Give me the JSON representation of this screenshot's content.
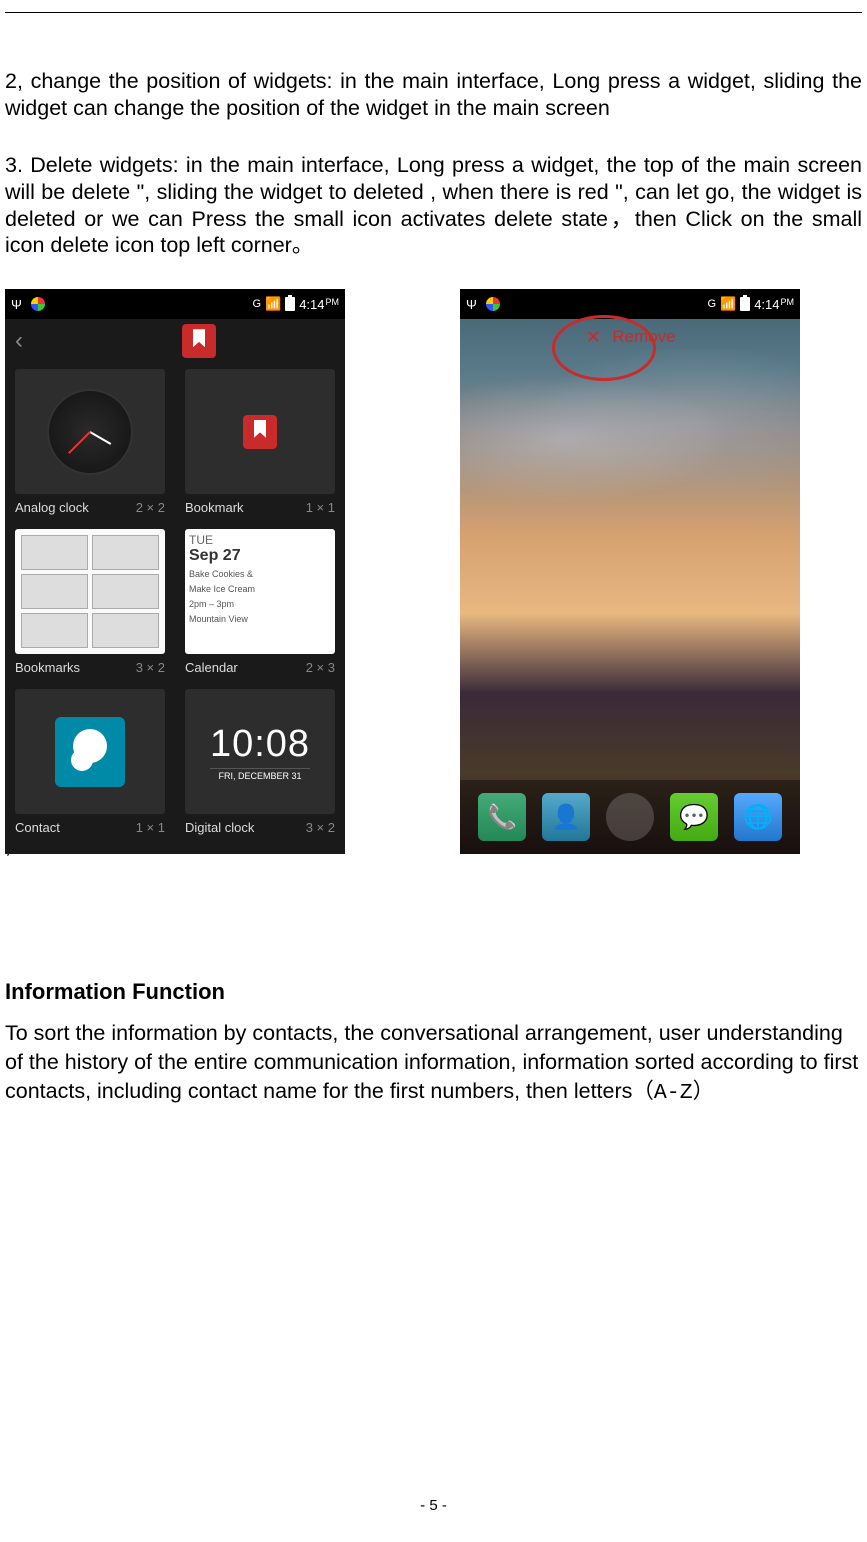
{
  "para1": "2, change the position of widgets: in the main interface, Long press a widget, sliding the widget can change the position of the widget in the main screen",
  "para2": "3. Delete widgets: in the main interface, Long press a widget, the top of the main screen will be delete \", sliding the widget to deleted , when there is red \", can let go, the widget is deleted or we can Press the small icon activates delete state，then Click on the small icon delete icon top left corner。",
  "ss1": {
    "status": {
      "gi": "G",
      "time": "4:14",
      "ampm": "PM"
    },
    "widgets": [
      {
        "name": "Analog clock",
        "size": "2 × 2"
      },
      {
        "name": "Bookmark",
        "size": "1 × 1"
      },
      {
        "name": "Bookmarks",
        "size": "3 × 2"
      },
      {
        "name": "Calendar",
        "size": "2 × 3"
      },
      {
        "name": "Contact",
        "size": "1 × 1"
      },
      {
        "name": "Digital clock",
        "size": "3 × 2"
      }
    ],
    "calendar": {
      "day": "TUE",
      "date": "Sep 27",
      "event1": "Bake Cookies &",
      "event2": "Make Ice Cream",
      "event3": "2pm – 3pm",
      "event4": "Mountain View"
    },
    "digital": {
      "time": "10:08",
      "date": "FRI, DECEMBER 31"
    }
  },
  "ss2": {
    "status": {
      "gi": "G",
      "time": "4:14",
      "ampm": "PM"
    },
    "remove_label": "Remove"
  },
  "comma": ",",
  "heading": "Information Function",
  "info_para": "To sort the information by contacts, the conversational arrangement, user understanding of the history of the entire communication information, information sorted according to first contacts, including contact name for the first numbers, then letters",
  "az_suffix": "（A-Z）",
  "page_num": "- 5 -"
}
